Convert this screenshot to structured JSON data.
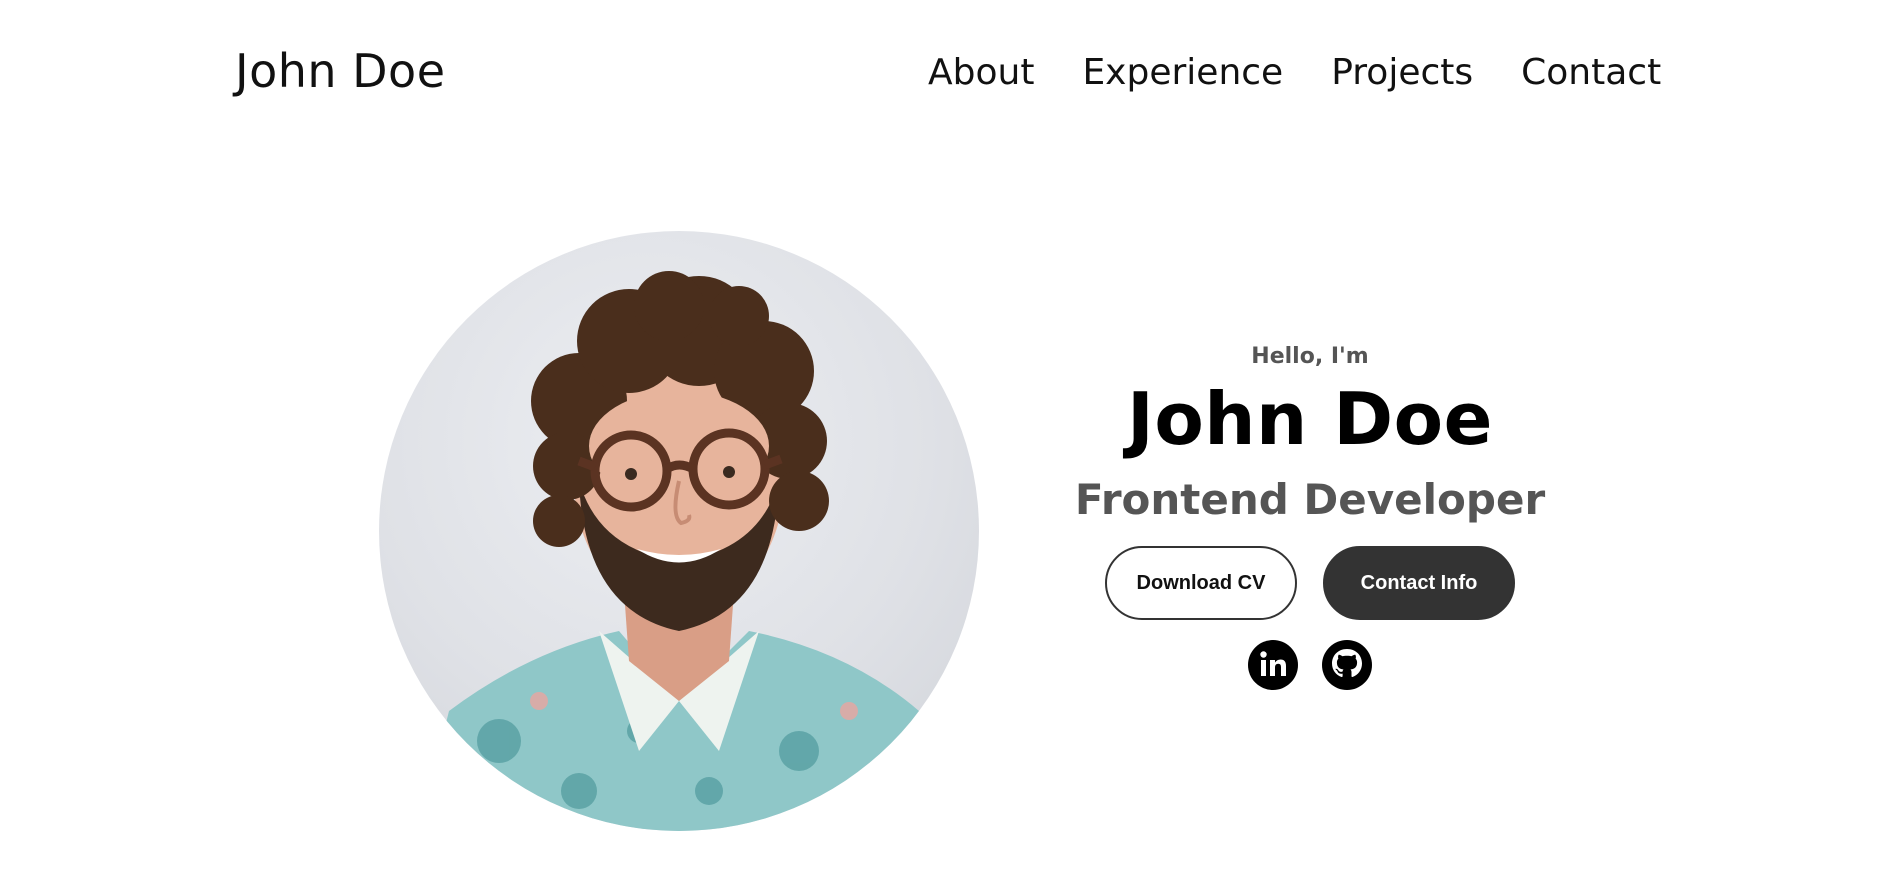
{
  "nav": {
    "logo": "John Doe",
    "links": [
      "About",
      "Experience",
      "Projects",
      "Contact"
    ]
  },
  "hero": {
    "greeting": "Hello, I'm",
    "name": "John Doe",
    "role": "Frontend Developer",
    "buttons": {
      "download": "Download CV",
      "contact": "Contact Info"
    },
    "socials": [
      "linkedin-icon",
      "github-icon"
    ]
  },
  "colors": {
    "text": "#111111",
    "muted": "#555555",
    "dark_button": "#333333",
    "background": "#ffffff"
  }
}
